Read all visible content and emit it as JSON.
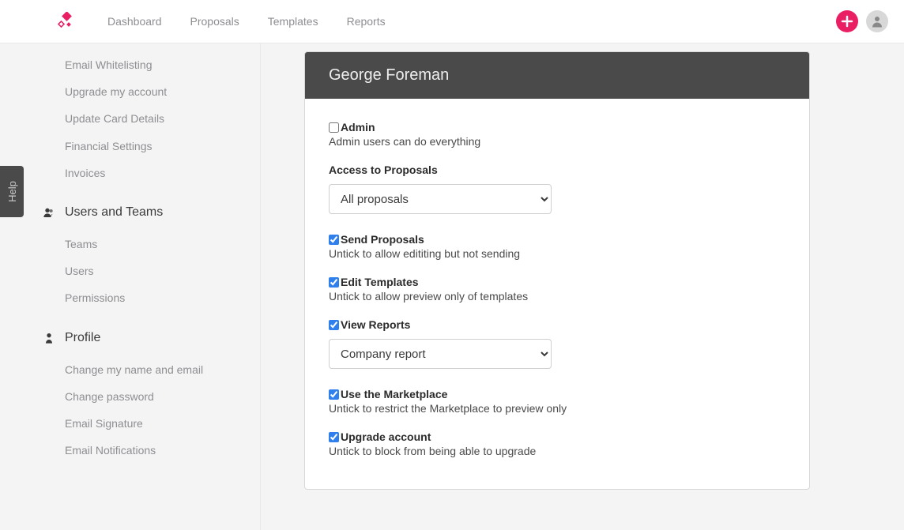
{
  "nav": {
    "items": [
      "Dashboard",
      "Proposals",
      "Templates",
      "Reports"
    ]
  },
  "help": {
    "label": "Help"
  },
  "sidebar": {
    "account_items": [
      "Email Whitelisting",
      "Upgrade my account",
      "Update Card Details",
      "Financial Settings",
      "Invoices"
    ],
    "users_teams_title": "Users and Teams",
    "users_teams_items": [
      "Teams",
      "Users",
      "Permissions"
    ],
    "profile_title": "Profile",
    "profile_items": [
      "Change my name and email",
      "Change password",
      "Email Signature",
      "Email Notifications"
    ]
  },
  "card": {
    "title": "George Foreman",
    "admin": {
      "label": "Admin",
      "desc": "Admin users can do everything",
      "checked": false
    },
    "access_proposals": {
      "label": "Access to Proposals",
      "selected": "All proposals"
    },
    "send_proposals": {
      "label": "Send Proposals",
      "desc": "Untick to allow edititing but not sending",
      "checked": true
    },
    "edit_templates": {
      "label": "Edit Templates",
      "desc": "Untick to allow preview only of templates",
      "checked": true
    },
    "view_reports": {
      "label": "View Reports",
      "selected": "Company report",
      "checked": true
    },
    "use_marketplace": {
      "label": "Use the Marketplace",
      "desc": "Untick to restrict the Marketplace to preview only",
      "checked": true
    },
    "upgrade_account": {
      "label": "Upgrade account",
      "desc": "Untick to block from being able to upgrade",
      "checked": true
    }
  }
}
